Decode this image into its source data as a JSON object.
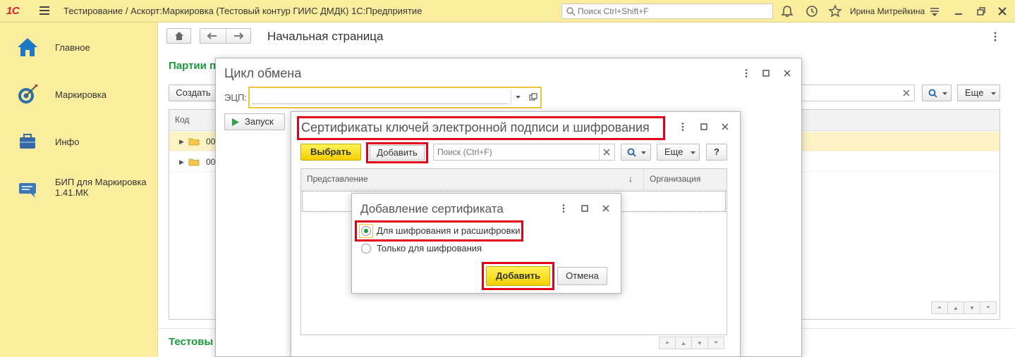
{
  "topbar": {
    "logo": "1С",
    "title": "Тестирование / Аскорт:Маркировка (Тестовый контур ГИИС ДМДК) 1С:Предприятие",
    "search_placeholder": "Поиск Ctrl+Shift+F",
    "user": "Ирина Митрейкина"
  },
  "sidebar": {
    "items": [
      {
        "label": "Главное",
        "icon": "home-icon"
      },
      {
        "label": "Маркировка",
        "icon": "target-icon"
      },
      {
        "label": "Инфо",
        "icon": "briefcase-icon"
      },
      {
        "label": "БИП для Маркировка 1.41.МК",
        "icon": "chat-icon"
      }
    ]
  },
  "main": {
    "page_title": "Начальная страница",
    "section1_title": "Партии п",
    "create_label": "Создать",
    "more_label": "Еще",
    "column_code": "Код",
    "rows": [
      {
        "code": "00"
      },
      {
        "code": "00"
      }
    ],
    "section2_title": "Тестовы"
  },
  "exchange_dialog": {
    "title": "Цикл обмена",
    "ecp_label": "ЭЦП:",
    "ecp_value": "",
    "run_label": "Запуск"
  },
  "cert_dialog": {
    "title": "Сертификаты ключей электронной подписи и шифрования",
    "select_label": "Выбрать",
    "add_label": "Добавить",
    "search_placeholder": "Поиск (Ctrl+F)",
    "more_label": "Еще",
    "help_label": "?",
    "col_view": "Представление",
    "col_org": "Организация"
  },
  "add_cert_dialog": {
    "title": "Добавление сертификата",
    "option1": "Для шифрования и расшифровки",
    "option2": "Только для шифрования",
    "selected_option": "option1",
    "add_label": "Добавить",
    "cancel_label": "Отмена"
  },
  "colors": {
    "yellow_panel": "#fbed9e",
    "accent_green": "#1b9a3e",
    "highlight_red": "#e0001b",
    "button_yellow": "#f2cf00"
  }
}
